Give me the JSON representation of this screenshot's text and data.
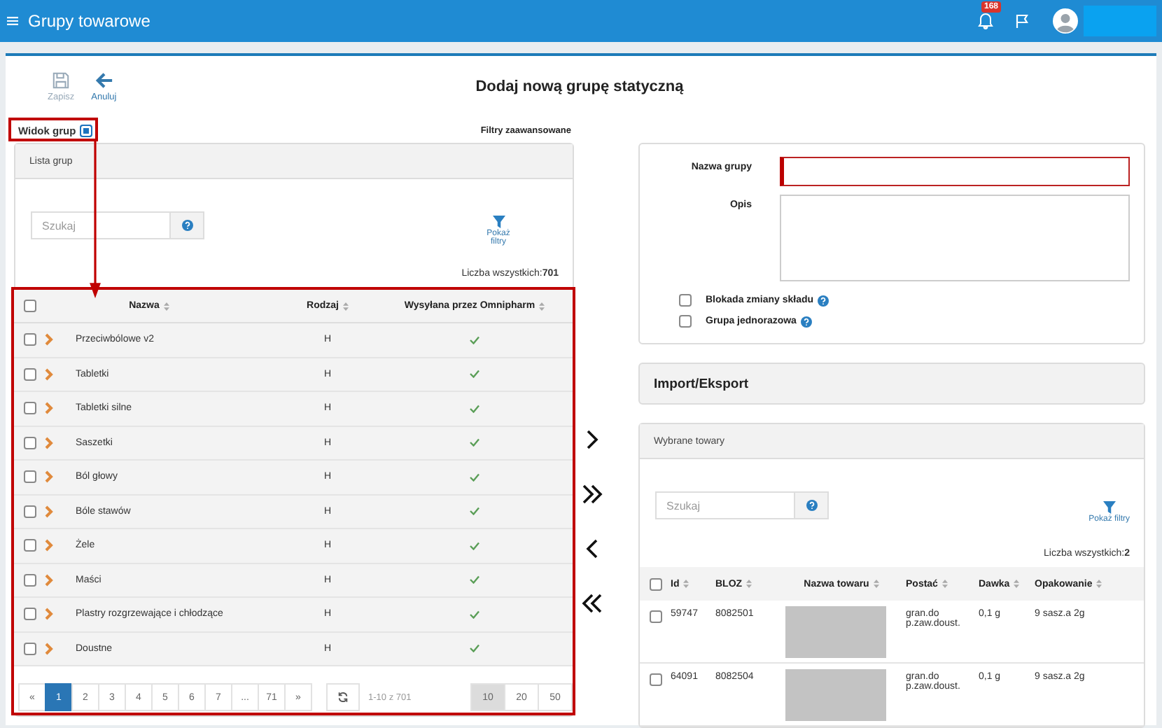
{
  "app_bar": {
    "title": "Grupy towarowe",
    "notification_count": "168"
  },
  "toolbar": [
    {
      "label": "Zapisz",
      "kind": "save",
      "disabled": true
    },
    {
      "label": "Anuluj",
      "kind": "cancel",
      "disabled": false
    }
  ],
  "page_title": "Dodaj nową grupę statyczną",
  "group_view": {
    "label": "Widok grup",
    "checked": true
  },
  "advanced_filters": "Filtry zaawansowane",
  "group_list": {
    "title": "Lista grup",
    "search": {
      "placeholder": "Szukaj"
    },
    "filter_button": "Pokaż filtry",
    "total_label": "Liczba wszystkich:",
    "total": "701",
    "columns": [
      "Nazwa",
      "Rodzaj",
      "Wysyłana przez Omnipharm"
    ],
    "all_checked": false,
    "rows": [
      {
        "checked": false,
        "name": "Przeciwbólowe v2",
        "type": "H",
        "sent": true
      },
      {
        "checked": false,
        "name": "Tabletki",
        "type": "H",
        "sent": true
      },
      {
        "checked": false,
        "name": "Tabletki silne",
        "type": "H",
        "sent": true
      },
      {
        "checked": false,
        "name": "Saszetki",
        "type": "H",
        "sent": true
      },
      {
        "checked": false,
        "name": "Ból głowy",
        "type": "H",
        "sent": true
      },
      {
        "checked": false,
        "name": "Bóle stawów",
        "type": "H",
        "sent": true
      },
      {
        "checked": false,
        "name": "Żele",
        "type": "H",
        "sent": true
      },
      {
        "checked": false,
        "name": "Maści",
        "type": "H",
        "sent": true
      },
      {
        "checked": false,
        "name": "Plastry rozgrzewające i chłodzące",
        "type": "H",
        "sent": true
      },
      {
        "checked": false,
        "name": "Doustne",
        "type": "H",
        "sent": true
      }
    ],
    "pagination": {
      "pages": [
        {
          "label": "«",
          "selected": false
        },
        {
          "label": "1",
          "selected": true
        },
        {
          "label": "2",
          "selected": false
        },
        {
          "label": "3",
          "selected": false
        },
        {
          "label": "4",
          "selected": false
        },
        {
          "label": "5",
          "selected": false
        },
        {
          "label": "6",
          "selected": false
        },
        {
          "label": "7",
          "selected": false
        },
        {
          "label": "...",
          "selected": false
        },
        {
          "label": "71",
          "selected": false
        },
        {
          "label": "»",
          "selected": false
        }
      ],
      "range": "1-10 z 701",
      "page_sizes": [
        {
          "label": "10",
          "selected": true
        },
        {
          "label": "20",
          "selected": false
        },
        {
          "label": "50",
          "selected": false
        }
      ]
    }
  },
  "form": {
    "fields": [
      {
        "label": "Nazwa grupy",
        "kind": "input",
        "invalid": true
      },
      {
        "label": "Opis",
        "kind": "textarea",
        "invalid": false
      }
    ],
    "options": [
      {
        "label": "Blokada zmiany składu",
        "checked": false
      },
      {
        "label": "Grupa jednorazowa",
        "checked": false
      }
    ]
  },
  "import_export": "Import/Eksport",
  "transfer_buttons": [
    {
      "kind": "add"
    },
    {
      "kind": "add_all"
    },
    {
      "kind": "remove"
    },
    {
      "kind": "remove_all"
    }
  ],
  "selected_products": {
    "title": "Wybrane towary",
    "search": {
      "placeholder": "Szukaj"
    },
    "filter_button": "Pokaż filtry",
    "total_label": "Liczba wszystkich:",
    "total": "2",
    "columns": [
      "Id",
      "BLOZ",
      "Nazwa towaru",
      "Postać",
      "Dawka",
      "Opakowanie"
    ],
    "all_checked": false,
    "rows": [
      {
        "checked": false,
        "id": "59747",
        "bloz": "8082501",
        "name_hidden": true,
        "form": "gran.do p.zaw.doust.",
        "dose": "0,1 g",
        "package": "9 sasz.a 2g"
      },
      {
        "checked": false,
        "id": "64091",
        "bloz": "8082504",
        "name_hidden": true,
        "form": "gran.do p.zaw.doust.",
        "dose": "0,1 g",
        "package": "9 sasz.a 2g"
      }
    ]
  }
}
